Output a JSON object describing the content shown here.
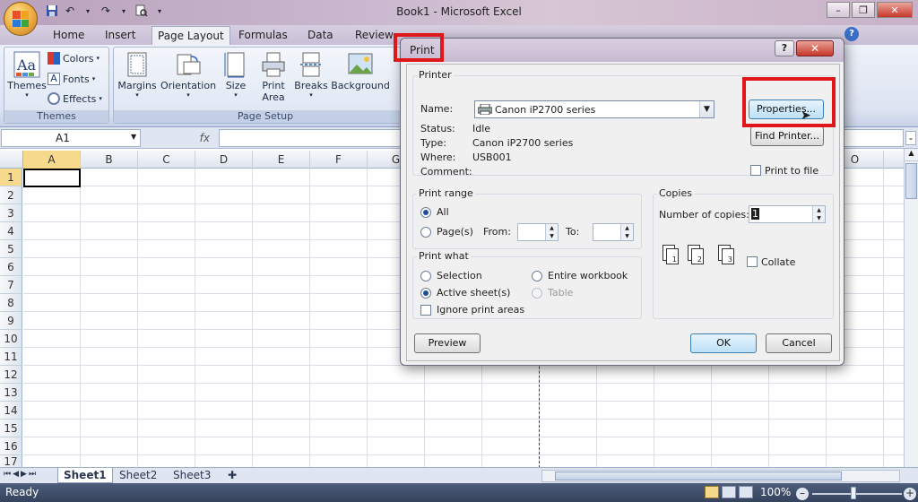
{
  "window": {
    "title": "Book1 - Microsoft Excel"
  },
  "tabs": [
    "Home",
    "Insert",
    "Page Layout",
    "Formulas",
    "Data",
    "Review"
  ],
  "ribbon": {
    "themes": {
      "themes_label": "Themes",
      "colors_label": "Colors",
      "fonts_label": "Fonts",
      "effects_label": "Effects",
      "group_label": "Themes"
    },
    "page_setup": {
      "margins": "Margins",
      "orientation": "Orientation",
      "size": "Size",
      "print_area_1": "Print",
      "print_area_2": "Area",
      "breaks": "Breaks",
      "background": "Background",
      "group_label": "Page Setup"
    }
  },
  "formula_bar": {
    "name_box": "A1",
    "fx": "fx"
  },
  "columns": [
    "A",
    "B",
    "C",
    "D",
    "E",
    "F",
    "G",
    "O"
  ],
  "rows": [
    "1",
    "2",
    "3",
    "4",
    "5",
    "6",
    "7",
    "8",
    "9",
    "10",
    "11",
    "12",
    "13",
    "14",
    "15",
    "16",
    "17"
  ],
  "sheets": [
    "Sheet1",
    "Sheet2",
    "Sheet3"
  ],
  "status": {
    "ready": "Ready",
    "zoom": "100%"
  },
  "dialog": {
    "title": "Print",
    "printer": {
      "legend": "Printer",
      "name_label": "Name:",
      "name_value": "Canon iP2700 series",
      "status_label": "Status:",
      "status_value": "Idle",
      "type_label": "Type:",
      "type_value": "Canon iP2700 series",
      "where_label": "Where:",
      "where_value": "USB001",
      "comment_label": "Comment:",
      "properties_button": "Properties...",
      "find_printer_button": "Find Printer...",
      "print_to_file": "Print to file"
    },
    "print_range": {
      "legend": "Print range",
      "all": "All",
      "pages": "Page(s)",
      "from": "From:",
      "to": "To:"
    },
    "print_what": {
      "legend": "Print what",
      "selection": "Selection",
      "entire_workbook": "Entire workbook",
      "active_sheets": "Active sheet(s)",
      "table": "Table",
      "ignore_print_areas": "Ignore print areas"
    },
    "copies": {
      "legend": "Copies",
      "number_label": "Number of copies:",
      "number_value": "1",
      "collate": "Collate",
      "icon_pages": [
        "1",
        "2",
        "3"
      ]
    },
    "preview_button": "Preview",
    "ok_button": "OK",
    "cancel_button": "Cancel"
  },
  "colors": {
    "highlight": "#e0161b",
    "statusbar": "#3f4e69"
  }
}
